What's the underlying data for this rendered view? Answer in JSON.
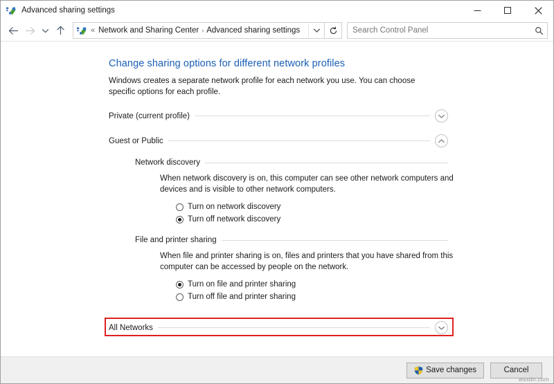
{
  "window": {
    "title": "Advanced sharing settings",
    "icon": "network-sharing-icon",
    "minimize_label": "Minimize",
    "maximize_label": "Maximize",
    "close_label": "Close"
  },
  "toolbar": {
    "back_label": "Back",
    "forward_label": "Forward",
    "recent_label": "Recent locations",
    "up_label": "Up one level",
    "refresh_label": "Refresh",
    "breadcrumb": {
      "overflow": "«",
      "items": [
        {
          "label": "Network and Sharing Center"
        },
        {
          "label": "Advanced sharing settings"
        }
      ],
      "separator": "›"
    },
    "address_dropdown_icon": "chevron-down-icon",
    "search": {
      "placeholder": "Search Control Panel",
      "value": "",
      "icon": "search-icon"
    }
  },
  "main": {
    "heading": "Change sharing options for different network profiles",
    "description": "Windows creates a separate network profile for each network you use. You can choose specific options for each profile.",
    "profiles": [
      {
        "label": "Private (current profile)",
        "expanded": false,
        "toggle_icon": "chevron-down-icon"
      },
      {
        "label": "Guest or Public",
        "expanded": true,
        "toggle_icon": "chevron-up-icon"
      }
    ],
    "sections": [
      {
        "title": "Network discovery",
        "description": "When network discovery is on, this computer can see other network computers and devices and is visible to other network computers.",
        "options": [
          {
            "label": "Turn on network discovery",
            "selected": false
          },
          {
            "label": "Turn off network discovery",
            "selected": true
          }
        ]
      },
      {
        "title": "File and printer sharing",
        "description": "When file and printer sharing is on, files and printers that you have shared from this computer can be accessed by people on the network.",
        "options": [
          {
            "label": "Turn on file and printer sharing",
            "selected": true
          },
          {
            "label": "Turn off file and printer sharing",
            "selected": false
          }
        ]
      }
    ],
    "all_networks": {
      "label": "All Networks",
      "expanded": false,
      "toggle_icon": "chevron-down-icon",
      "highlighted": true,
      "highlight_color": "#e02020"
    }
  },
  "footer": {
    "save_label": "Save changes",
    "save_icon": "uac-shield-icon",
    "cancel_label": "Cancel",
    "watermark": "wsxdn.com"
  },
  "colors": {
    "heading_blue": "#1a5fb4",
    "highlight_red": "#e02020",
    "text": "#1b1b1b",
    "rule": "#dcdcdc",
    "footer_bg": "#f0f0f0"
  }
}
